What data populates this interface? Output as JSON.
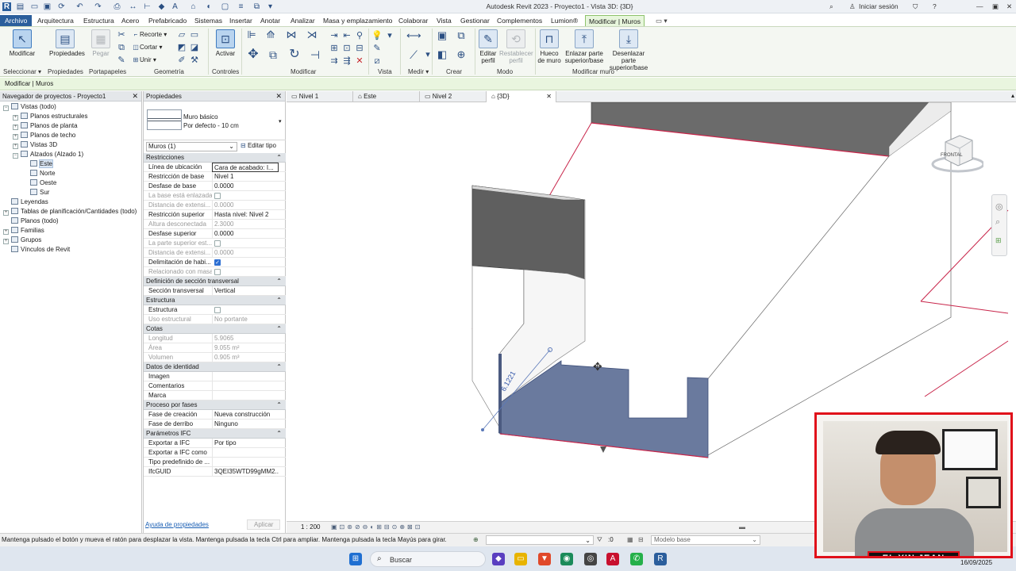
{
  "window": {
    "title": "Autodesk Revit 2023 - Proyecto1 - Vista 3D: {3D}",
    "signin": "Iniciar sesión"
  },
  "ribbon_tabs": [
    "Archivo",
    "Arquitectura",
    "Estructura",
    "Acero",
    "Prefabricado",
    "Sistemas",
    "Insertar",
    "Anotar",
    "Analizar",
    "Masa y emplazamiento",
    "Colaborar",
    "Vista",
    "Gestionar",
    "Complementos",
    "Lumion®",
    "Modificar | Muros"
  ],
  "ribbon": {
    "modify": "Modificar",
    "properties": "Propiedades",
    "paste": "Pegar",
    "cut_tool": "Recorte",
    "cut": "Cortar",
    "join": "Unir",
    "activate": "Activar",
    "edit_profile": "Editar perfil",
    "reset_profile": "Restablecer perfil",
    "wall_opening": "Hueco de muro",
    "attach_top_base": "Enlazar parte superior/base",
    "detach_top_base": "Desenlazar parte superior/base",
    "groups": [
      "Seleccionar",
      "Propiedades",
      "Portapapeles",
      "Geometría",
      "Controles",
      "Modificar",
      "Vista",
      "Medir",
      "Crear",
      "Modo",
      "Modificar muro"
    ]
  },
  "options_bar": "Modificar | Muros",
  "project_browser": {
    "title": "Navegador de proyectos - Proyecto1",
    "items": [
      {
        "label": "Vistas (todo)",
        "level": 0,
        "toggle": "−"
      },
      {
        "label": "Planos estructurales",
        "level": 1,
        "toggle": "+"
      },
      {
        "label": "Planos de planta",
        "level": 1,
        "toggle": "+"
      },
      {
        "label": "Planos de techo",
        "level": 1,
        "toggle": "+"
      },
      {
        "label": "Vistas 3D",
        "level": 1,
        "toggle": "+"
      },
      {
        "label": "Alzados (Alzado 1)",
        "level": 1,
        "toggle": "−"
      },
      {
        "label": "Este",
        "level": 2,
        "toggle": "",
        "selected": true
      },
      {
        "label": "Norte",
        "level": 2,
        "toggle": ""
      },
      {
        "label": "Oeste",
        "level": 2,
        "toggle": ""
      },
      {
        "label": "Sur",
        "level": 2,
        "toggle": ""
      },
      {
        "label": "Leyendas",
        "level": 0,
        "toggle": ""
      },
      {
        "label": "Tablas de planificación/Cantidades (todo)",
        "level": 0,
        "toggle": "+"
      },
      {
        "label": "Planos (todo)",
        "level": 0,
        "toggle": ""
      },
      {
        "label": "Familias",
        "level": 0,
        "toggle": "+"
      },
      {
        "label": "Grupos",
        "level": 0,
        "toggle": "+"
      },
      {
        "label": "Vínculos de Revit",
        "level": 0,
        "toggle": ""
      }
    ]
  },
  "properties": {
    "title": "Propiedades",
    "type_name": "Muro básico",
    "type_sub": "Por defecto - 10 cm",
    "filter": "Muros (1)",
    "edit_type": "Editar tipo",
    "help": "Ayuda de propiedades",
    "apply": "Aplicar",
    "sections": [
      {
        "title": "Restricciones",
        "rows": [
          {
            "k": "Línea de ubicación",
            "v": "Cara de acabado: I..."
          },
          {
            "k": "Restricción de base",
            "v": "Nivel 1"
          },
          {
            "k": "Desfase de base",
            "v": "0.0000"
          },
          {
            "k": "La base está enlazada",
            "check": false,
            "dis": true
          },
          {
            "k": "Distancia de extensi...",
            "v": "0.0000",
            "dis": true
          },
          {
            "k": "Restricción superior",
            "v": "Hasta nivel: Nivel 2"
          },
          {
            "k": "Altura desconectada",
            "v": "2.3000",
            "dis": true
          },
          {
            "k": "Desfase superior",
            "v": "0.0000"
          },
          {
            "k": "La parte superior est...",
            "check": false,
            "dis": true
          },
          {
            "k": "Distancia de extensi...",
            "v": "0.0000",
            "dis": true
          },
          {
            "k": "Delimitación de habi...",
            "check": true
          },
          {
            "k": "Relacionado con masa",
            "check": false,
            "dis": true
          }
        ]
      },
      {
        "title": "Definición de sección transversal",
        "rows": [
          {
            "k": "Sección transversal",
            "v": "Vertical"
          }
        ]
      },
      {
        "title": "Estructura",
        "rows": [
          {
            "k": "Estructura",
            "check": false
          },
          {
            "k": "Uso estructural",
            "v": "No portante",
            "dis": true
          }
        ]
      },
      {
        "title": "Cotas",
        "rows": [
          {
            "k": "Longitud",
            "v": "5.9065",
            "dis": true
          },
          {
            "k": "Área",
            "v": "9.055 m²",
            "dis": true
          },
          {
            "k": "Volumen",
            "v": "0.905 m³",
            "dis": true
          }
        ]
      },
      {
        "title": "Datos de identidad",
        "rows": [
          {
            "k": "Imagen",
            "v": ""
          },
          {
            "k": "Comentarios",
            "v": ""
          },
          {
            "k": "Marca",
            "v": ""
          }
        ]
      },
      {
        "title": "Proceso por fases",
        "rows": [
          {
            "k": "Fase de creación",
            "v": "Nueva construcción"
          },
          {
            "k": "Fase de derribo",
            "v": "Ninguno"
          }
        ]
      },
      {
        "title": "Parámetros IFC",
        "rows": [
          {
            "k": "Exportar a IFC",
            "v": "Por tipo"
          },
          {
            "k": "Exportar a IFC como",
            "v": ""
          },
          {
            "k": "Tipo predefinido de ...",
            "v": ""
          },
          {
            "k": "IfcGUID",
            "v": "3QEI35WTD99gMM2..."
          }
        ]
      }
    ]
  },
  "view_tabs": [
    {
      "label": "Nivel 1"
    },
    {
      "label": "Este"
    },
    {
      "label": "Nivel 2"
    },
    {
      "label": "{3D}",
      "active": true
    }
  ],
  "viewport": {
    "dimension_label": "6.1221",
    "viewcube_label": "FRONTAL"
  },
  "view_control": {
    "scale": "1 : 200"
  },
  "status": {
    "message": "Mantenga pulsado el botón y mueva el ratón para desplazar la vista. Mantenga pulsada la tecla Ctrl para ampliar. Mantenga pulsada la tecla Mayús para girar.",
    "selection_count": ":0",
    "model": "Modelo base"
  },
  "taskbar": {
    "search": "Buscar",
    "date": "16/09/2025"
  },
  "overlay": {
    "name": "EL YIN JEAN"
  },
  "colors": {
    "accent": "#2b5e9c",
    "context_tab": "#e7f6dc",
    "wall_selected": "#6a7a9e",
    "model_edge": "#c8254a"
  }
}
